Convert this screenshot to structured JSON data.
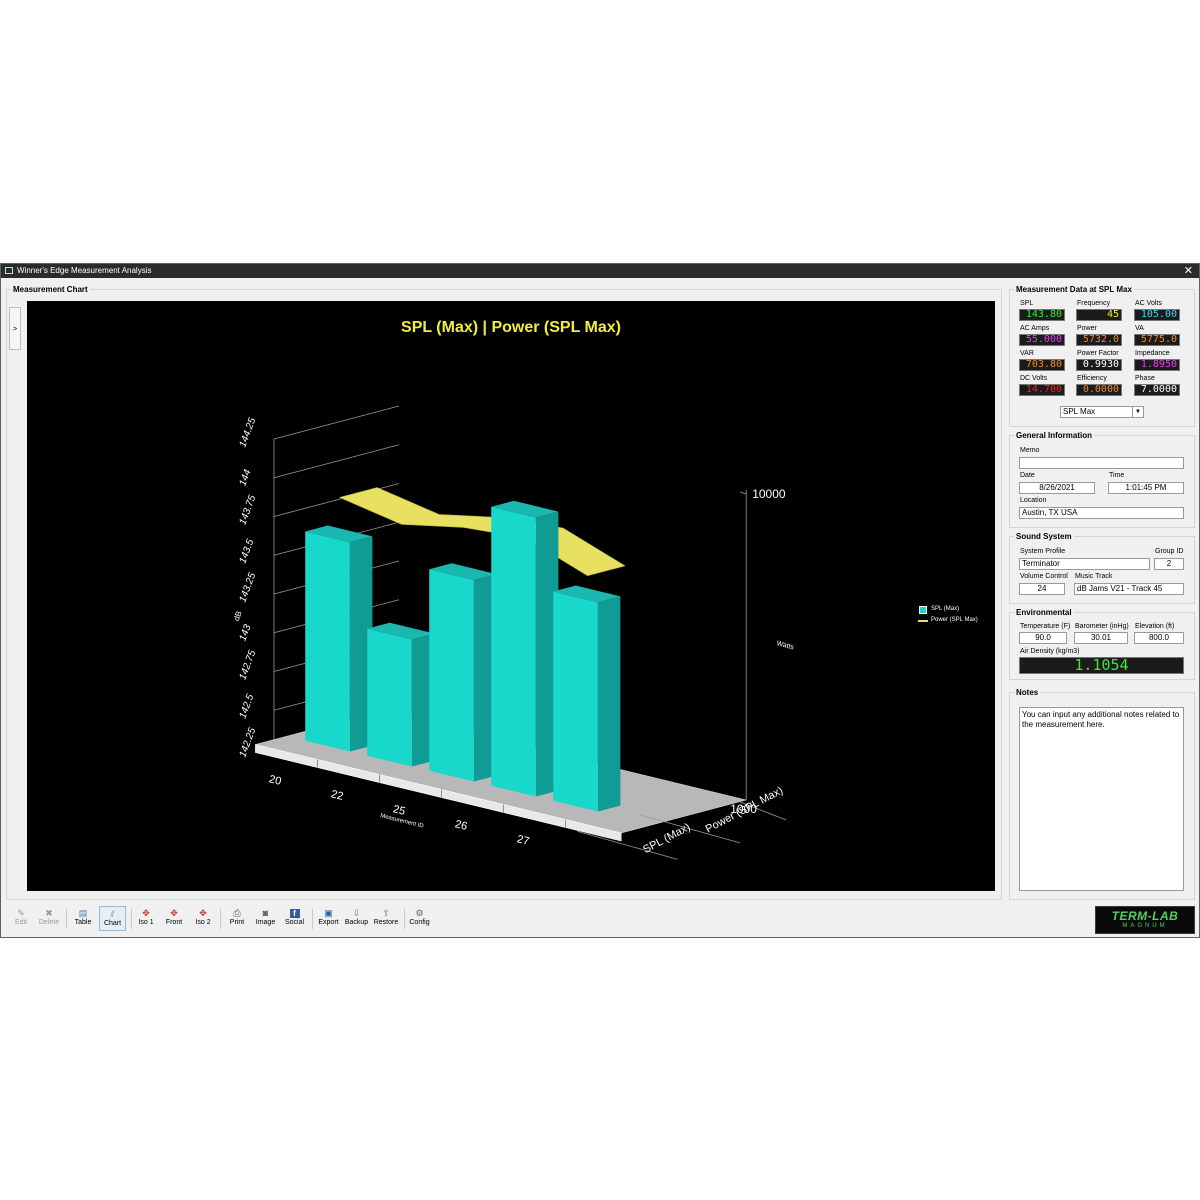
{
  "window": {
    "title": "Winner's Edge Measurement Analysis",
    "close": "✕"
  },
  "chart_panel": {
    "legend": "Measurement Chart",
    "side_toggle": ">",
    "chart": {
      "title": "SPL (Max) | Power (SPL Max)",
      "left_axis_label": "dB",
      "left_ticks": [
        "142.25",
        "142.5",
        "142.75",
        "143",
        "143.25",
        "143.5",
        "143.75",
        "144",
        "144.25"
      ],
      "right_axis_label": "Watts",
      "right_ticks": [
        "1000",
        "10000"
      ],
      "x_axis_label": "Measurement ID",
      "x_ticks": [
        "20",
        "22",
        "25",
        "26",
        "27"
      ],
      "depth_labels": [
        "Power (SPL Max)",
        "SPL (Max)"
      ],
      "legend": [
        {
          "name": "SPL (Max)",
          "color": "#18d8cc"
        },
        {
          "name": "Power (SPL Max)",
          "color": "#e8e060"
        }
      ]
    }
  },
  "chart_data": {
    "type": "bar",
    "title": "SPL (Max) | Power (SPL Max)",
    "xlabel": "Measurement ID",
    "ylabel": "dB",
    "y2label": "Watts",
    "y2_scale": "log",
    "categories": [
      "20",
      "22",
      "25",
      "26",
      "27"
    ],
    "ylim": [
      142.25,
      144.25
    ],
    "y2lim": [
      1000,
      10000
    ],
    "series": [
      {
        "name": "SPL (Max)",
        "type": "bar",
        "values": [
          143.6,
          143.07,
          143.55,
          144.05,
          143.6
        ]
      },
      {
        "name": "Power (SPL Max)",
        "type": "line",
        "values": [
          5900,
          5400,
          5900,
          6100,
          5150
        ]
      }
    ],
    "legend_position": "right"
  },
  "measurement": {
    "legend": "Measurement Data at SPL Max",
    "readouts": [
      {
        "label": "SPL",
        "value": "143.80",
        "color": "#38e838"
      },
      {
        "label": "Frequency",
        "value": "45",
        "color": "#f0f040"
      },
      {
        "label": "AC Volts",
        "value": "105.00",
        "color": "#38d8f0"
      },
      {
        "label": "AC Amps",
        "value": "55.000",
        "color": "#e040f0"
      },
      {
        "label": "Power",
        "value": "5732.0",
        "color": "#f08828"
      },
      {
        "label": "VA",
        "value": "5775.0",
        "color": "#f08828"
      },
      {
        "label": "VAR",
        "value": "703.80",
        "color": "#f08828"
      },
      {
        "label": "Power Factor",
        "value": "0.9930",
        "color": "#ffffff"
      },
      {
        "label": "Impedance",
        "value": "1.8950",
        "color": "#e040f0"
      },
      {
        "label": "DC Volts",
        "value": "14.700",
        "color": "#f02020"
      },
      {
        "label": "Efficiency",
        "value": "0.0000",
        "color": "#f08828"
      },
      {
        "label": "Phase",
        "value": "7.0000",
        "color": "#ffffff"
      }
    ],
    "select_value": "SPL Max"
  },
  "general": {
    "legend": "General Information",
    "memo_label": "Memo",
    "memo_value": "",
    "date_label": "Date",
    "date_value": "8/26/2021",
    "time_label": "Time",
    "time_value": "1:01:45 PM",
    "location_label": "Location",
    "location_value": "Austin, TX USA"
  },
  "sound": {
    "legend": "Sound System",
    "profile_label": "System Profile",
    "profile_value": "Terminator",
    "group_label": "Group ID",
    "group_value": "2",
    "volume_label": "Volume Control",
    "volume_value": "24",
    "track_label": "Music Track",
    "track_value": "dB Jams V21 - Track 45"
  },
  "environment": {
    "legend": "Environmental",
    "temp_label": "Temperature (F)",
    "temp_value": "90.0",
    "baro_label": "Barometer (inHg)",
    "baro_value": "30.01",
    "elev_label": "Elevation (ft)",
    "elev_value": "800.0",
    "air_label": "Air Density (kg/m3)",
    "air_value": "1.1054"
  },
  "notes": {
    "legend": "Notes",
    "text": "You can input any additional notes related to the measurement here."
  },
  "toolbar": {
    "edit": "Edit",
    "delete": "Delete",
    "table": "Table",
    "chart": "Chart",
    "iso1": "Iso 1",
    "front": "Front",
    "iso2": "Iso 2",
    "print": "Print",
    "image": "Image",
    "social": "Social",
    "export": "Export",
    "backup": "Backup",
    "restore": "Restore",
    "config": "Config"
  },
  "logo": {
    "line1": "TERM-LAB",
    "line2": "MAGNUM"
  }
}
